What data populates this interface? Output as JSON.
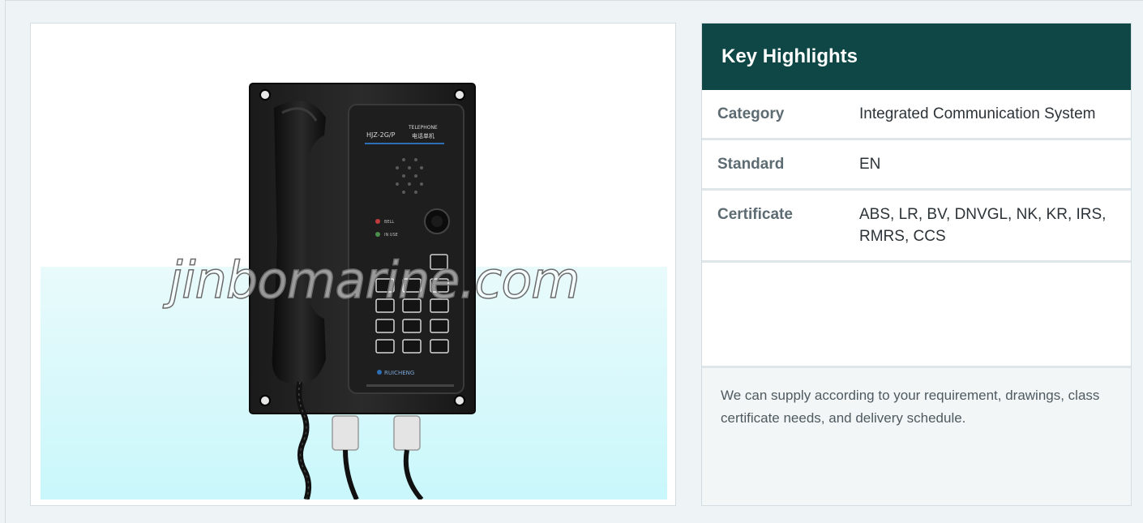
{
  "product": {
    "image_alt": "Marine telephone HJZ-2G/P",
    "watermark": "jinbomarine.com",
    "device": {
      "model": "HJZ-2G/P",
      "label_en": "TELEPHONE",
      "label_cn": "电话单机",
      "bell_label": "BELL",
      "bell_cn": "振铃",
      "work_label": "IN USE",
      "work_cn": "工作",
      "brand": "RUICHENG"
    }
  },
  "highlights": {
    "title": "Key Highlights",
    "rows": [
      {
        "key": "Category",
        "value": "Integrated Communication System"
      },
      {
        "key": "Standard",
        "value": "EN"
      },
      {
        "key": "Certificate",
        "value": "ABS, LR, BV, DNVGL, NK, KR, IRS, RMRS, CCS"
      }
    ],
    "note": "We can supply according to your requirement, drawings, class certificate needs, and delivery schedule."
  },
  "colors": {
    "header_bg": "#0e4745",
    "page_bg": "#eef3f5",
    "photo_wash": "#d6f9fb"
  }
}
